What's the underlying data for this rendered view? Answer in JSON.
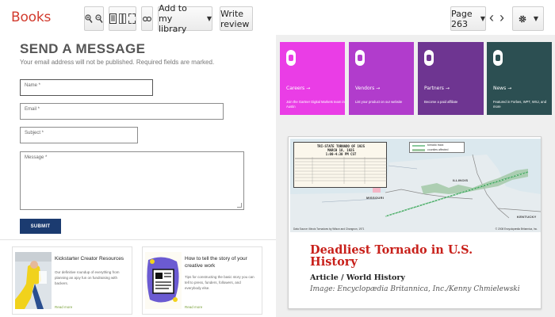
{
  "toolbar": {
    "brand": "Books",
    "add_library_label": "Add to my library",
    "write_review_label": "Write review",
    "page_label": "Page 263"
  },
  "form": {
    "title": "SEND A MESSAGE",
    "note": "Your email address will not be published. Required fields are marked.",
    "name_placeholder": "Name *",
    "email_placeholder": "Email *",
    "subject_placeholder": "Subject *",
    "message_placeholder": "Message *",
    "submit_label": "SUBMIT"
  },
  "cards": [
    {
      "title": "Kickstarter Creator Resources",
      "desc": "Our definitive roundup of everything from planning an ajoy fun on fundraising with backers.",
      "link": "Read more"
    },
    {
      "title": "How to tell the story of your creative work",
      "desc": "Tips for constructing the basic story you can tell to press, funders, followers, and everybody else.",
      "link": "Read more"
    }
  ],
  "tiles": [
    {
      "name": "Careers →",
      "desc": "Join the Gartner Digital Markets team in Austin",
      "color": "#ea3de6"
    },
    {
      "name": "Vendors →",
      "desc": "List your product on our website",
      "color": "#b13ccc"
    },
    {
      "name": "Partners →",
      "desc": "Become a paid affiliate",
      "color": "#6e3591"
    },
    {
      "name": "News →",
      "desc": "Featured in Forbes, WPT, WSJ, and more",
      "color": "#2c4f52"
    }
  ],
  "feature": {
    "map": {
      "table_title": "TRI-STATE TORNADO OF 1925\nMARCH 18, 1925\n1:00-4:30 PM CST",
      "legend_track": "tornado track",
      "legend_counties": "counties affected",
      "state_illinois": "ILLINOIS",
      "state_missouri": "MISSOURI",
      "state_kentucky": "KENTUCKY",
      "credit": "Data Source: Illinois Tornadoes by Wilson and Changnon, 1971",
      "credit_right": "© 2008 Encyclopædia Britannica, Inc."
    },
    "title": "Deadliest Tornado in U.S. History",
    "kind": "Article / World History",
    "credit": "Image: Encyclopædia Britannica, Inc./Kenny Chmielewski"
  }
}
